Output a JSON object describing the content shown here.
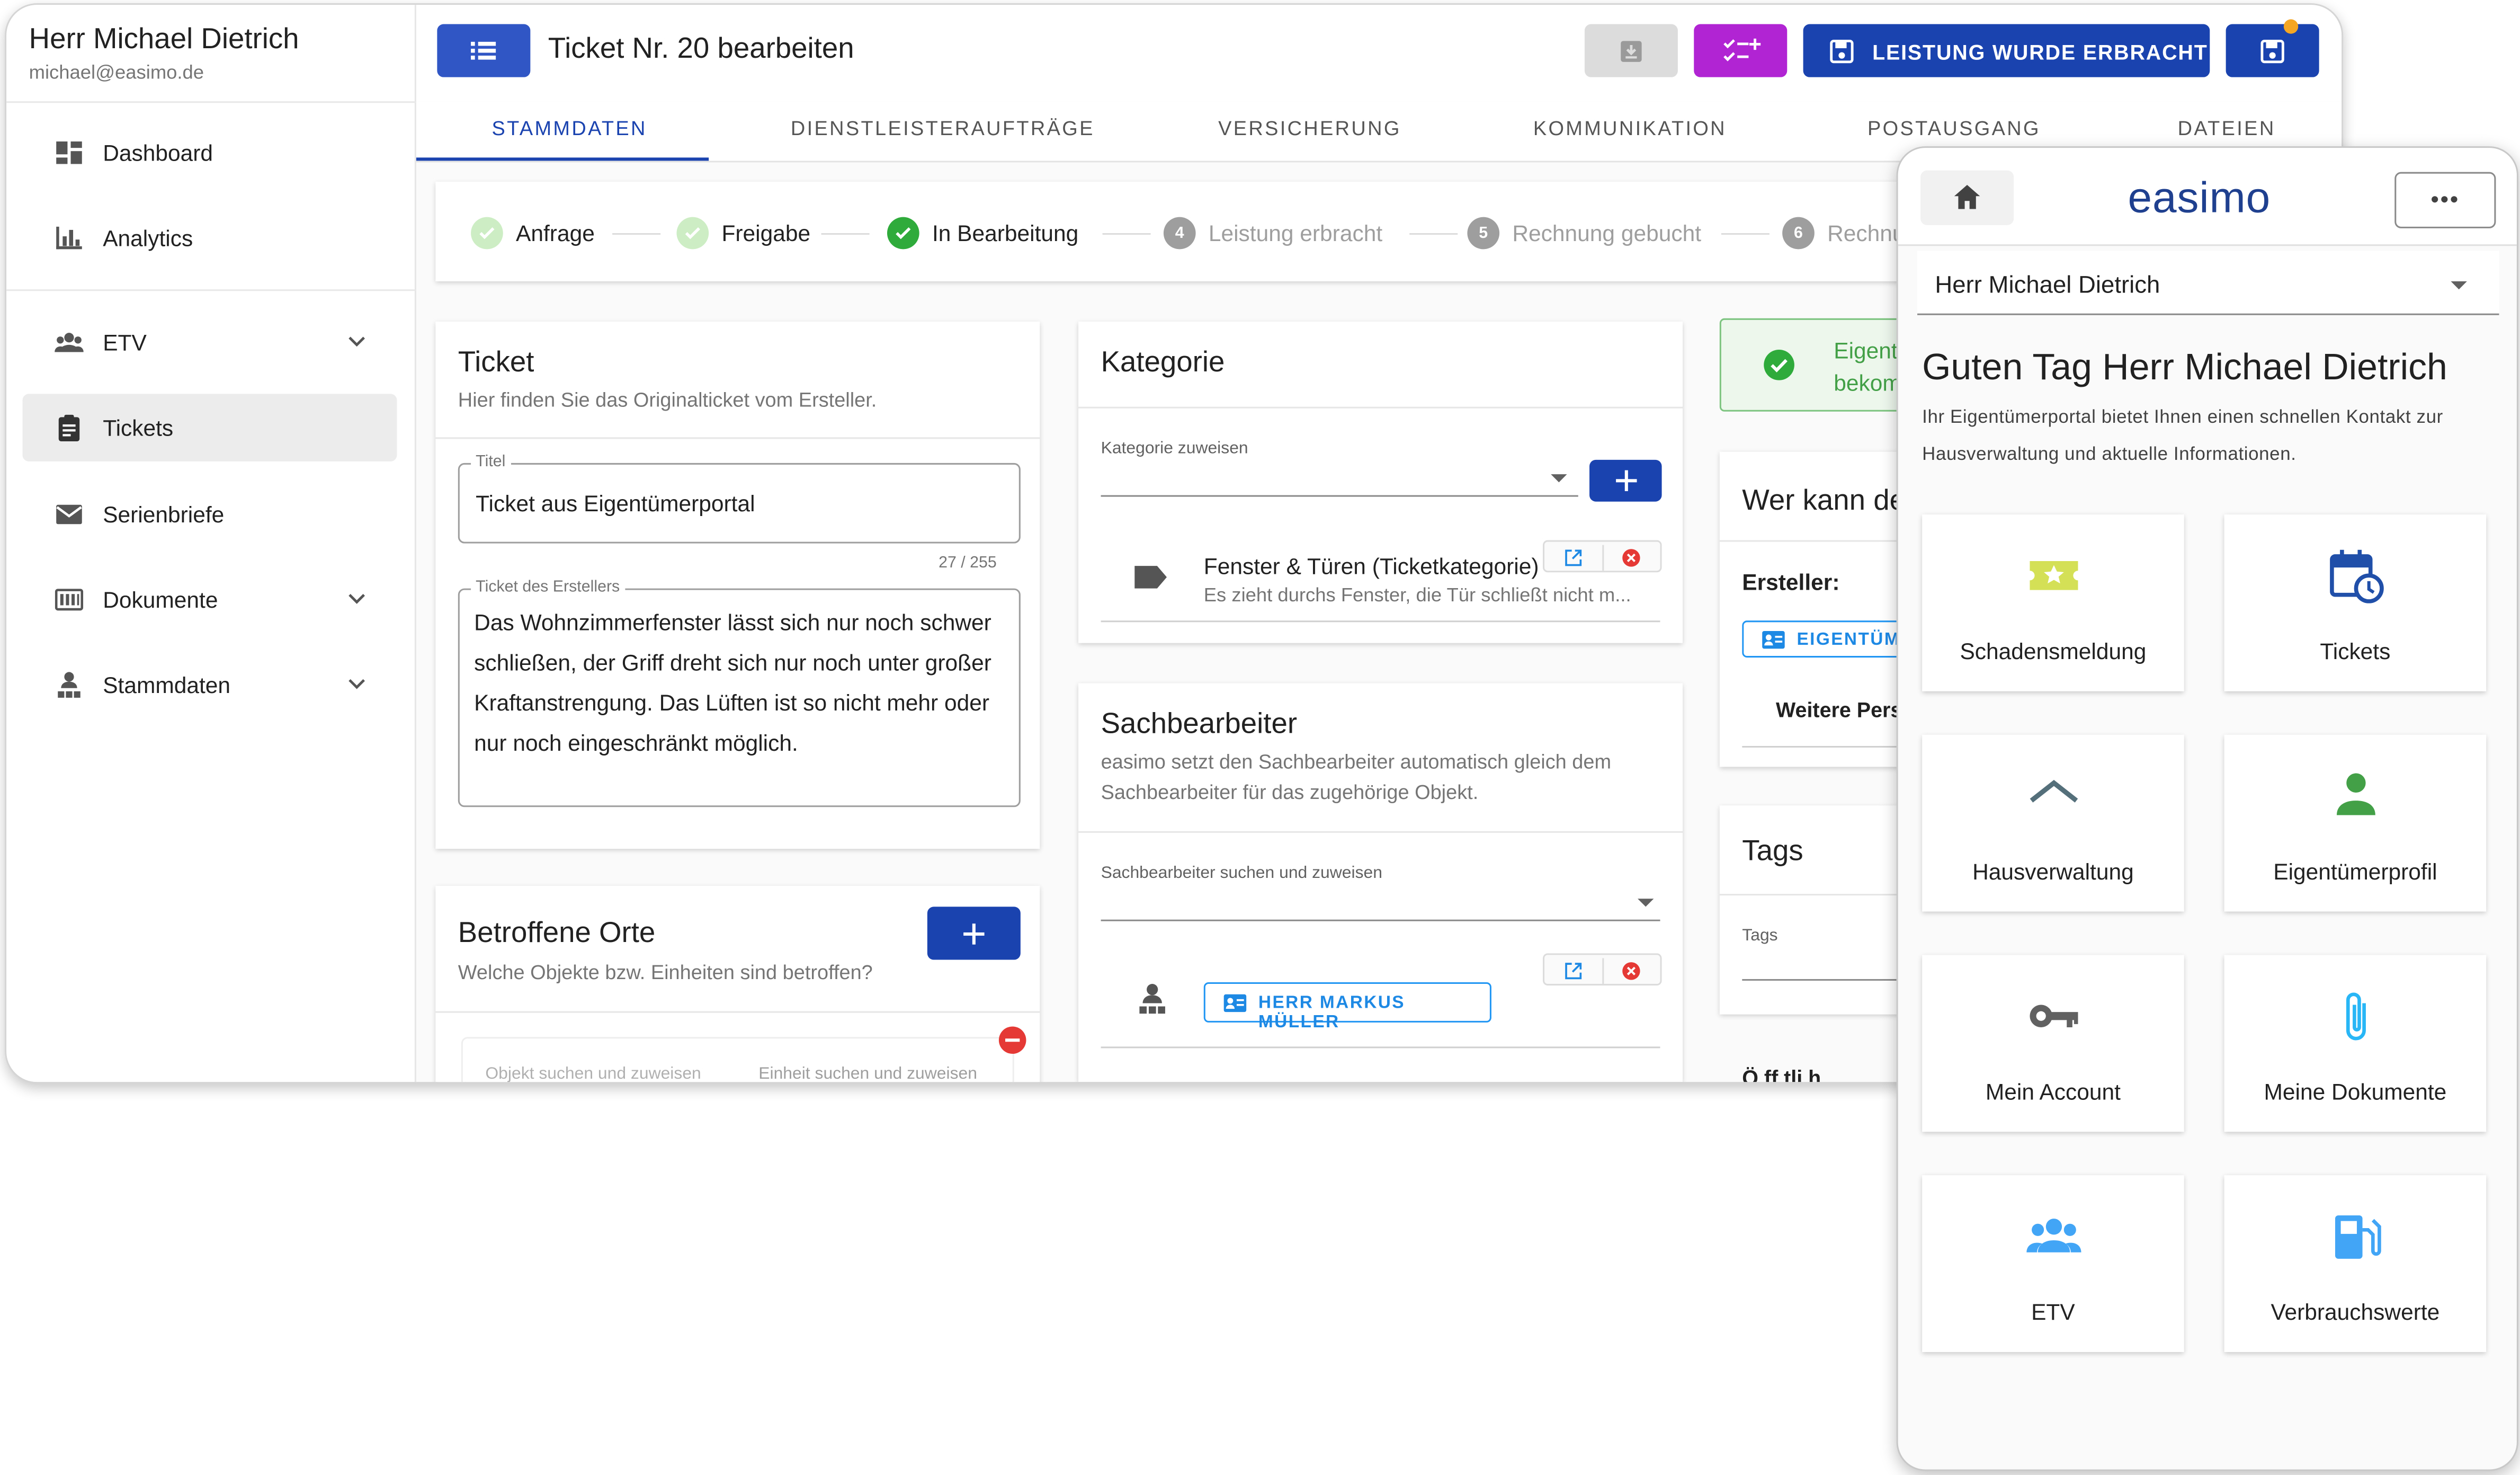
{
  "desktop": {
    "user": {
      "name": "Herr Michael Dietrich",
      "email": "michael@easimo.de"
    },
    "nav": [
      {
        "label": "Dashboard",
        "icon": "dashboard-icon"
      },
      {
        "label": "Analytics",
        "icon": "bar-chart-icon"
      },
      {
        "label": "ETV",
        "icon": "group-icon",
        "expandable": true
      },
      {
        "label": "Tickets",
        "icon": "clipboard-icon",
        "active": true
      },
      {
        "label": "Serienbriefe",
        "icon": "mail-icon"
      },
      {
        "label": "Dokumente",
        "icon": "documents-icon",
        "expandable": true
      },
      {
        "label": "Stammdaten",
        "icon": "person-tree-icon",
        "expandable": true
      }
    ],
    "page_title": "Ticket Nr. 20 bearbeiten",
    "toolbar": {
      "primary_label": "LEISTUNG WURDE ERBRACHT"
    },
    "tabs": [
      "STAMMDATEN",
      "DIENSTLEISTERAUFTRÄGE",
      "VERSICHERUNG",
      "KOMMUNIKATION",
      "POSTAUSGANG",
      "DATEIEN"
    ],
    "steps": [
      {
        "label": "Anfrage",
        "state": "done"
      },
      {
        "label": "Freigabe",
        "state": "done"
      },
      {
        "label": "In Bearbeitung",
        "state": "current"
      },
      {
        "num": "4",
        "label": "Leistung erbracht",
        "state": "pending"
      },
      {
        "num": "5",
        "label": "Rechnung gebucht",
        "state": "pending"
      },
      {
        "num": "6",
        "label": "Rechnu",
        "state": "pending"
      }
    ],
    "ticket": {
      "title": "Ticket",
      "subtitle": "Hier finden Sie das Originalticket vom Ersteller.",
      "title_field_label": "Titel",
      "title_field_value": "Ticket aus Eigentümerportal",
      "counter": "27 / 255",
      "text_field_label": "Ticket des Erstellers",
      "text_field_value": "Das Wohnzimmerfenster lässt sich nur noch schwer schließen, der Griff dreht sich nur noch unter großer Kraftanstrengung. Das Lüften ist so nicht mehr oder nur noch eingeschränkt möglich."
    },
    "orte": {
      "title": "Betroffene Orte",
      "subtitle": "Welche Objekte bzw. Einheiten sind betroffen?",
      "objekt_placeholder": "Objekt suchen und zuweisen",
      "einheit_placeholder": "Einheit suchen und zuweisen"
    },
    "kategorie": {
      "title": "Kategorie",
      "assign_label": "Kategorie zuweisen",
      "item_title": "Fenster & Türen (Ticketkategorie)",
      "item_desc": "Es zieht durchs Fenster, die Tür schließt nicht m..."
    },
    "sachbearbeiter": {
      "title": "Sachbearbeiter",
      "subtitle": "easimo setzt den Sachbearbeiter automatisch gleich dem Sachbearbeiter für das zugehörige Objekt.",
      "search_label": "Sachbearbeiter suchen und zuweisen",
      "assigned": "HERR MARKUS MÜLLER"
    },
    "right_col": {
      "notice_line1": "Eigent",
      "notice_line2": "bekom",
      "who_title": "Wer kann de",
      "creator_label": "Ersteller:",
      "creator_chip": "EIGENTÜME",
      "more_persons": "Weitere Pers",
      "tags_title": "Tags",
      "tags_label": "Tags",
      "cut_heading": "Ö  ff  tli  h"
    }
  },
  "mobile": {
    "logo": "easimo",
    "user_select": "Herr Michael Dietrich",
    "greeting": "Guten Tag Herr Michael Dietrich",
    "intro": "Ihr Eigentümerportal bietet Ihnen einen schnellen Kontakt zur Hausverwaltung und aktuelle Informationen.",
    "tiles": [
      {
        "label": "Schadensmeldung",
        "icon": "damage-report-icon",
        "color": "#d4e157"
      },
      {
        "label": "Tickets",
        "icon": "calendar-clock-icon",
        "color": "#1f4fa8"
      },
      {
        "label": "Hausverwaltung",
        "icon": "roof-icon",
        "color": "#546e7a"
      },
      {
        "label": "Eigentümerprofil",
        "icon": "person-icon",
        "color": "#43a047"
      },
      {
        "label": "Mein Account",
        "icon": "key-icon",
        "color": "#616161"
      },
      {
        "label": "Meine Dokumente",
        "icon": "paperclip-icon",
        "color": "#29b6f6"
      },
      {
        "label": "ETV",
        "icon": "group-icon",
        "color": "#42a5f5"
      },
      {
        "label": "Verbrauchswerte",
        "icon": "fuel-icon",
        "color": "#42a5f5"
      }
    ]
  }
}
